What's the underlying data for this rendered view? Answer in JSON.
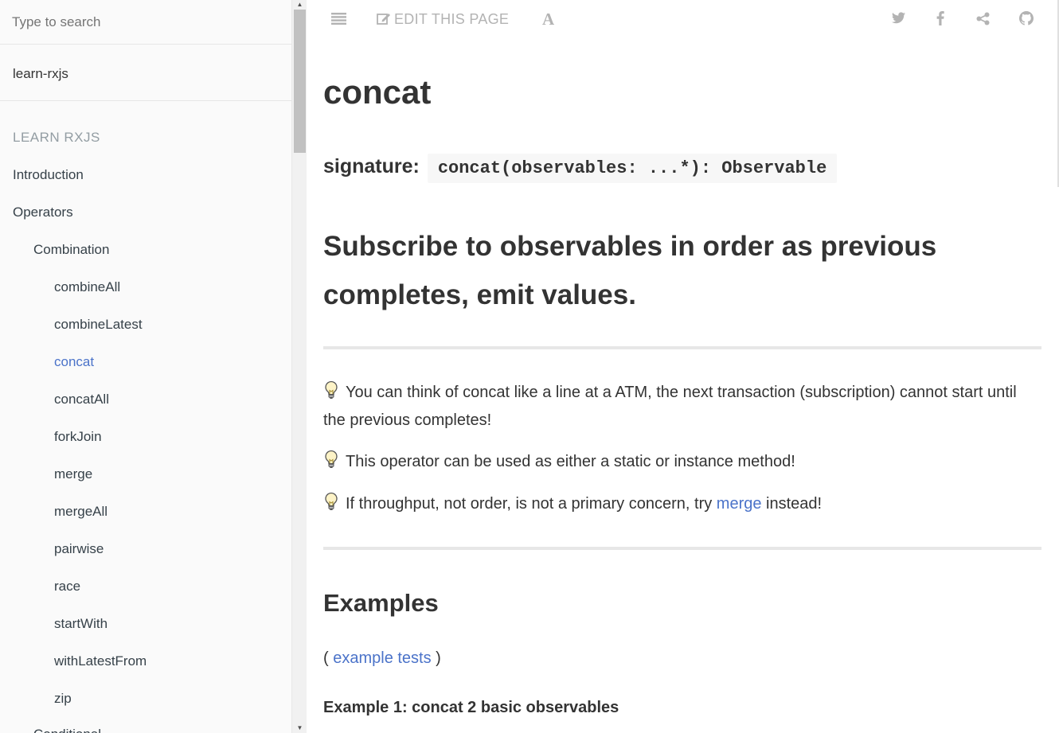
{
  "search": {
    "placeholder": "Type to search"
  },
  "book": {
    "title": "learn-rxjs"
  },
  "sidebar": {
    "section_header": "LEARN RXJS",
    "items": [
      {
        "label": "Introduction",
        "level": 0,
        "active": false
      },
      {
        "label": "Operators",
        "level": 0,
        "active": false
      },
      {
        "label": "Combination",
        "level": 1,
        "active": false
      },
      {
        "label": "combineAll",
        "level": 2,
        "active": false
      },
      {
        "label": "combineLatest",
        "level": 2,
        "active": false
      },
      {
        "label": "concat",
        "level": 2,
        "active": true
      },
      {
        "label": "concatAll",
        "level": 2,
        "active": false
      },
      {
        "label": "forkJoin",
        "level": 2,
        "active": false
      },
      {
        "label": "merge",
        "level": 2,
        "active": false
      },
      {
        "label": "mergeAll",
        "level": 2,
        "active": false
      },
      {
        "label": "pairwise",
        "level": 2,
        "active": false
      },
      {
        "label": "race",
        "level": 2,
        "active": false
      },
      {
        "label": "startWith",
        "level": 2,
        "active": false
      },
      {
        "label": "withLatestFrom",
        "level": 2,
        "active": false
      },
      {
        "label": "zip",
        "level": 2,
        "active": false
      },
      {
        "label": "Conditional",
        "level": 1,
        "active": false
      }
    ]
  },
  "toolbar": {
    "edit_label": "EDIT THIS PAGE",
    "font_label": "A",
    "icons": [
      "menu-icon",
      "edit-icon",
      "font-icon",
      "twitter-icon",
      "facebook-icon",
      "share-icon",
      "github-icon"
    ]
  },
  "content": {
    "title": "concat",
    "signature_label": "signature:",
    "signature_code": "concat(observables: ...*): Observable",
    "subtitle": "Subscribe to observables in order as previous completes, emit values.",
    "tips": [
      {
        "text": "You can think of concat like a line at a ATM, the next transaction (subscription) cannot start until the previous completes!"
      },
      {
        "text": "This operator can be used as either a static or instance method!"
      },
      {
        "before": "If throughput, not order, is not a primary concern, try ",
        "link": "merge",
        "after": " instead!"
      }
    ],
    "examples_heading": "Examples",
    "examples_open": "( ",
    "examples_link": "example tests",
    "examples_close": " )",
    "example1_title": "Example 1: concat 2 basic observables"
  },
  "colors": {
    "link": "#4b73c9",
    "toolbar_icon": "#b3b3b3",
    "sidebar_bg": "#fafafa"
  }
}
